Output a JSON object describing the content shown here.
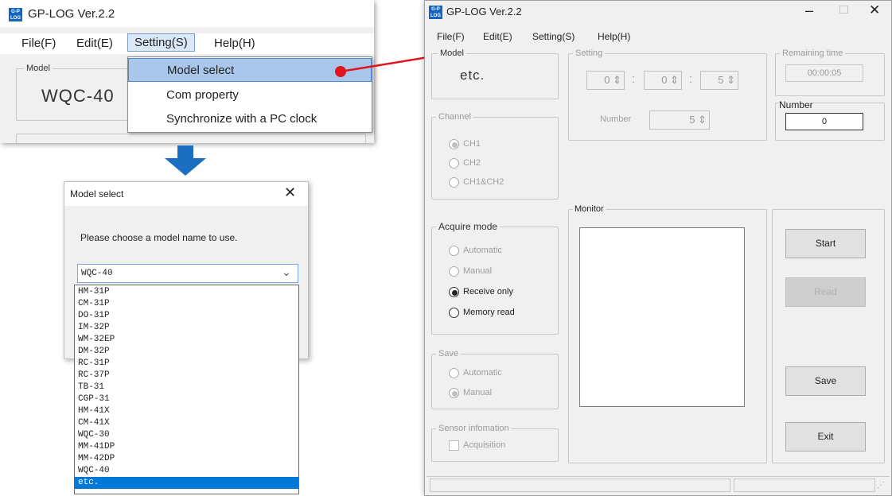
{
  "inset_menu": {
    "window_title": "GP-LOG Ver.2.2",
    "menus": [
      "File(F)",
      "Edit(E)",
      "Setting(S)",
      "Help(H)"
    ],
    "model_group_label": "Model",
    "model_value": "WQC-40",
    "dropdown_items": [
      "Model select",
      "Com property",
      "Synchronize with a PC clock"
    ]
  },
  "dialog": {
    "title": "Model select",
    "prompt": "Please choose a model name to use.",
    "selected": "WQC-40",
    "options": [
      "HM-31P",
      "CM-31P",
      "DO-31P",
      "IM-32P",
      "WM-32EP",
      "DM-32P",
      "RC-31P",
      "RC-37P",
      "TB-31",
      "CGP-31",
      "HM-41X",
      "CM-41X",
      "WQC-30",
      "MM-41DP",
      "MM-42DP",
      "WQC-40",
      "etc."
    ],
    "highlighted": "etc."
  },
  "main_window": {
    "title": "GP-LOG Ver.2.2",
    "menus": [
      "File(F)",
      "Edit(E)",
      "Setting(S)",
      "Help(H)"
    ],
    "model_group_label": "Model",
    "model_value": "etc.",
    "setting_group_label": "Setting",
    "time_fields": [
      "0",
      "0",
      "5"
    ],
    "number_label_setting": "Number",
    "number_setting_value": "5",
    "remaining_label": "Remaining time",
    "remaining_value": "00:00:05",
    "number_label": "Number",
    "number_value": "0",
    "channel_label": "Channel",
    "channels": [
      "CH1",
      "CH2",
      "CH1&CH2"
    ],
    "acquire_label": "Acquire mode",
    "acquire_modes": [
      "Automatic",
      "Manual",
      "Receive only",
      "Memory read"
    ],
    "monitor_label": "Monitor",
    "save_label": "Save",
    "save_modes": [
      "Automatic",
      "Manual"
    ],
    "sensor_label": "Sensor infomation",
    "sensor_checkbox": "Acquisition",
    "buttons": {
      "start": "Start",
      "read": "Read",
      "save": "Save",
      "exit": "Exit"
    }
  },
  "colors": {
    "highlight_circle": "#e0141e",
    "arrow_blue": "#1a6fc2",
    "selection_blue": "#0078d7"
  }
}
